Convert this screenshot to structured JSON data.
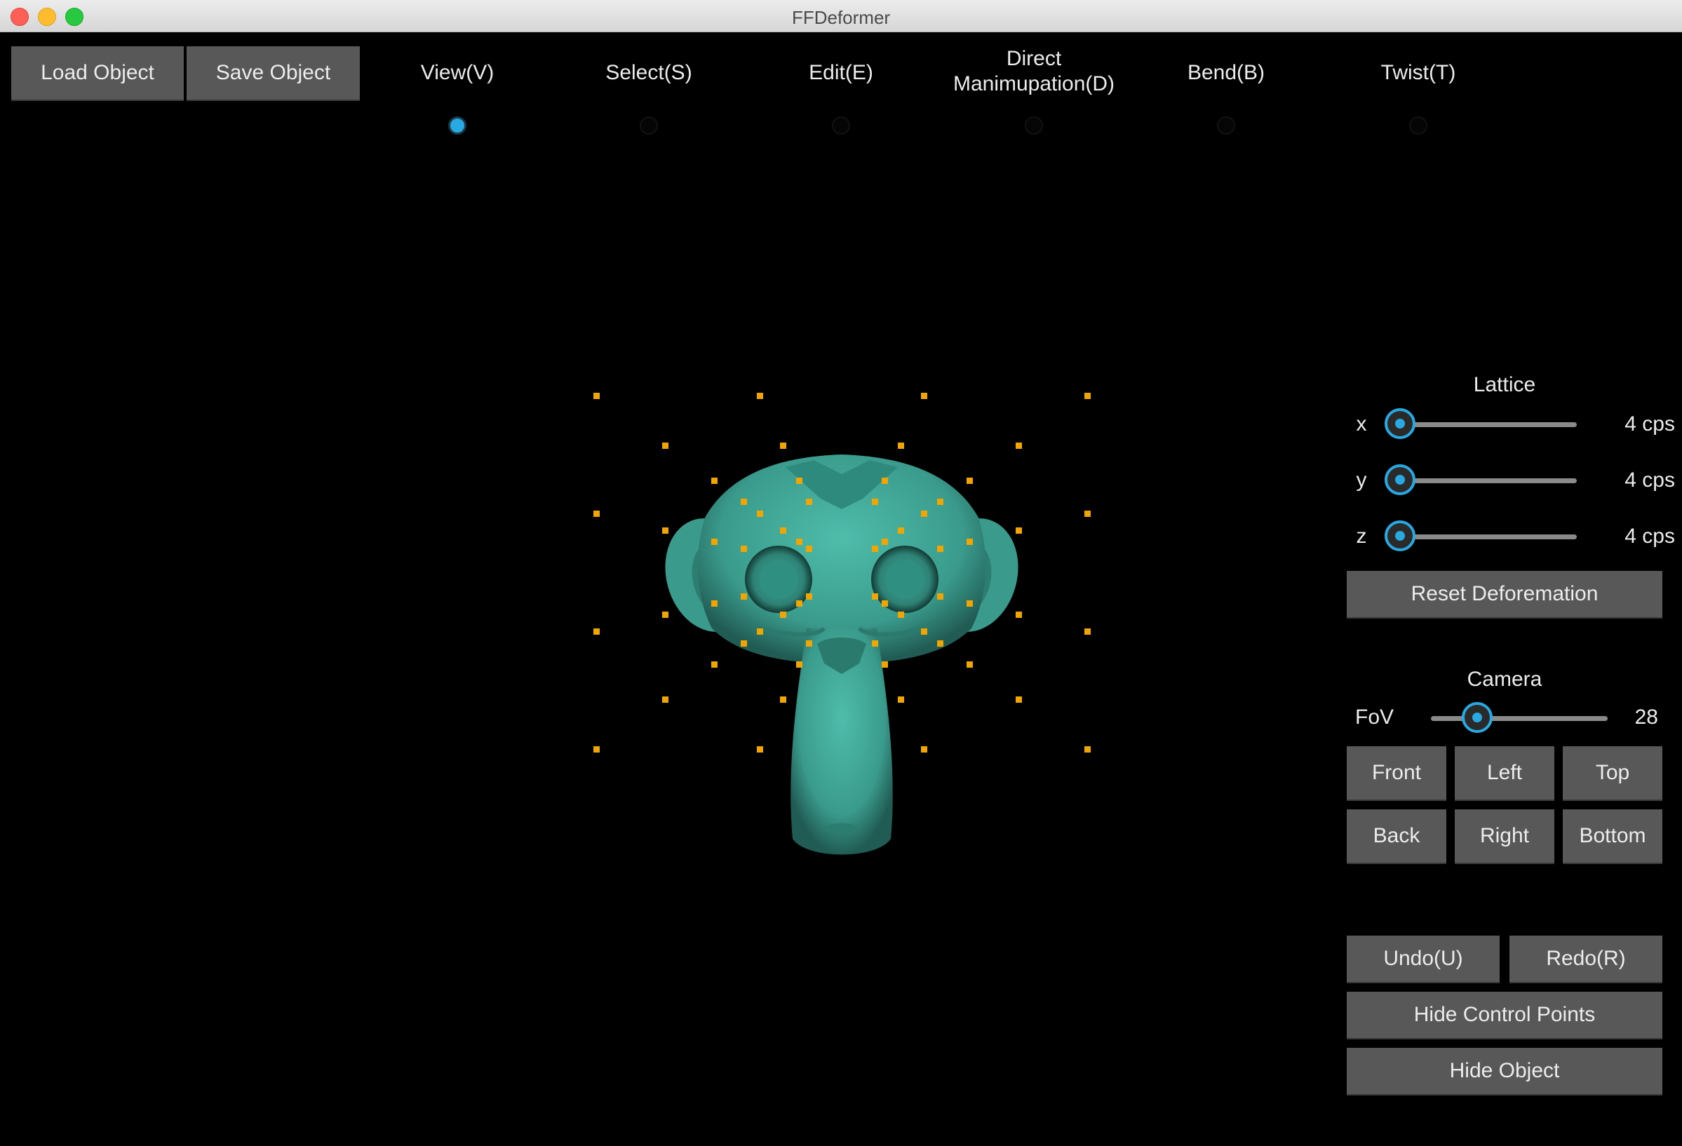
{
  "window": {
    "title": "FFDeformer"
  },
  "toolbar": {
    "load_label": "Load Object",
    "save_label": "Save Object"
  },
  "modes": [
    {
      "label": "View(V)",
      "selected": true
    },
    {
      "label": "Select(S)",
      "selected": false
    },
    {
      "label": "Edit(E)",
      "selected": false
    },
    {
      "label": "Direct\nManimupation(D)",
      "selected": false
    },
    {
      "label": "Bend(B)",
      "selected": false
    },
    {
      "label": "Twist(T)",
      "selected": false
    }
  ],
  "lattice": {
    "title": "Lattice",
    "x_label": "x",
    "x_value": "4 cps",
    "x_level": 0,
    "y_label": "y",
    "y_value": "4 cps",
    "y_level": 0,
    "z_label": "z",
    "z_value": "4 cps",
    "z_level": 0,
    "reset_label": "Reset Deforemation"
  },
  "camera": {
    "title": "Camera",
    "fov_label": "FoV",
    "fov_value": "28",
    "fov_level": 0.26,
    "front_label": "Front",
    "left_label": "Left",
    "top_label": "Top",
    "back_label": "Back",
    "right_label": "Right",
    "bottom_label": "Bottom"
  },
  "actions": {
    "undo_label": "Undo(U)",
    "redo_label": "Redo(R)",
    "hide_cp_label": "Hide Control Points",
    "hide_object_label": "Hide Object"
  },
  "colors": {
    "accent": "#29a9e1",
    "control_point": "#f0a500",
    "mesh": "#3a9b8c",
    "button": "#585858"
  }
}
